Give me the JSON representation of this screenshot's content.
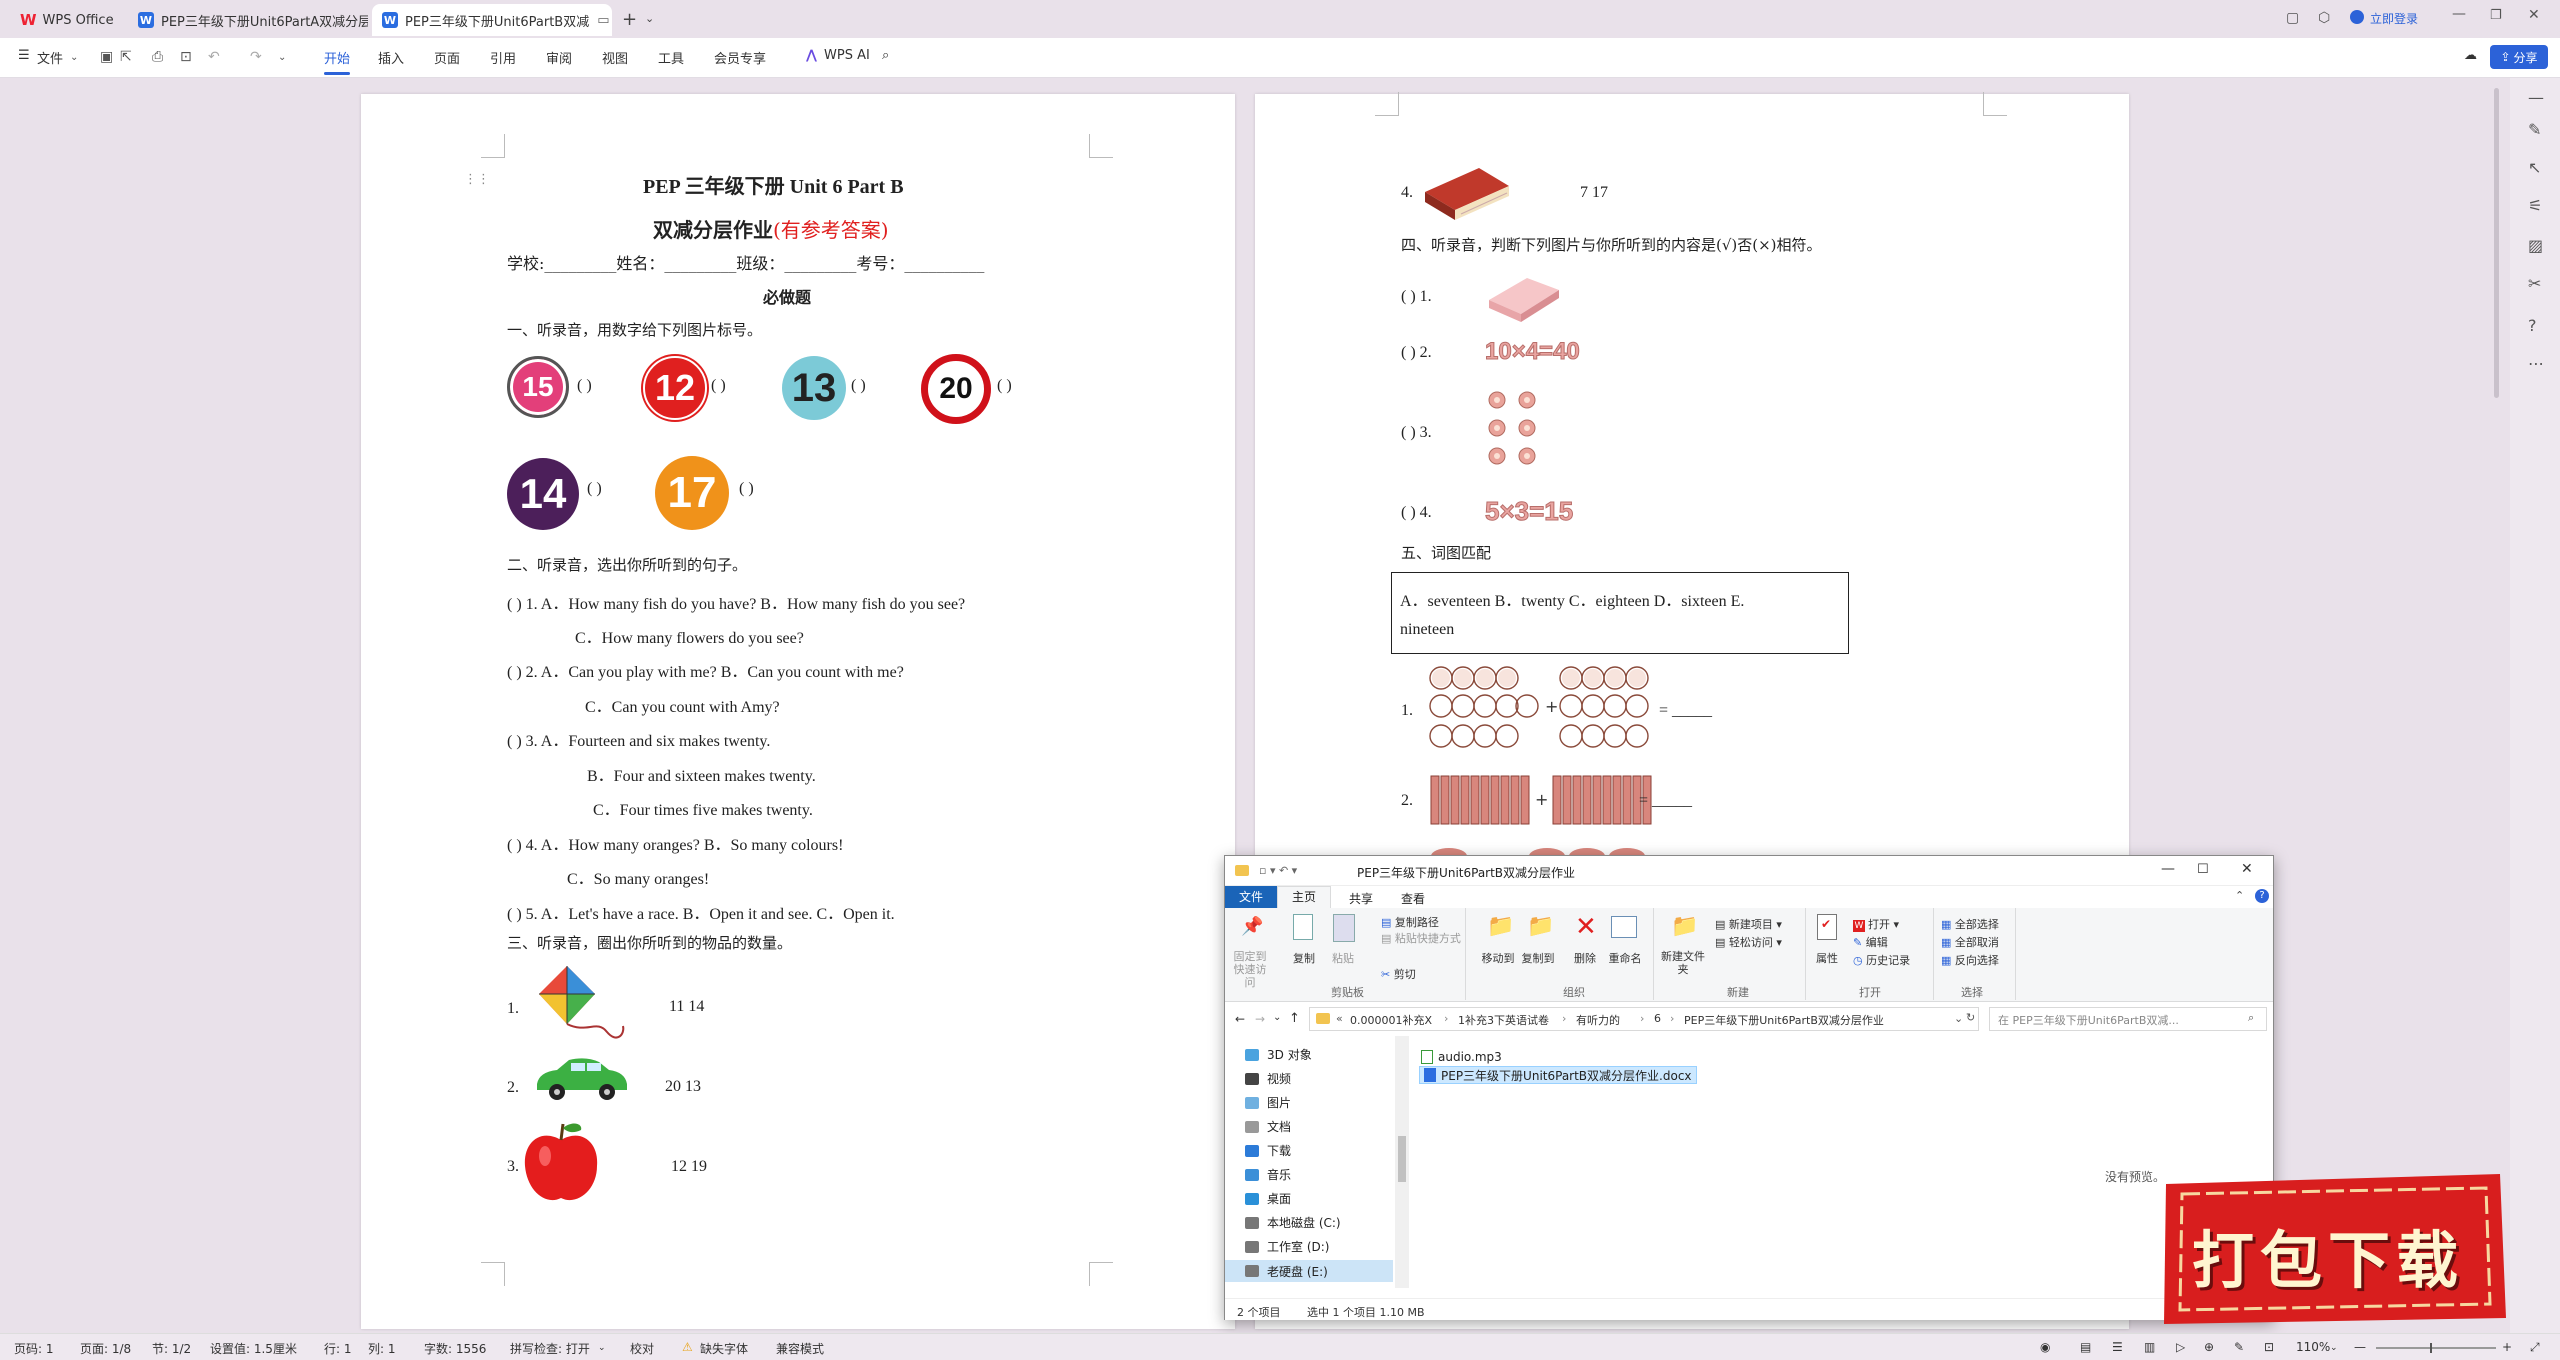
{
  "tabs": [
    {
      "label": "WPS Office"
    },
    {
      "label": "PEP三年级下册Unit6PartA双减分层作"
    },
    {
      "label": "PEP三年级下册Unit6PartB双减"
    }
  ],
  "titlebar": {
    "login": "立即登录"
  },
  "menu": {
    "file": "文件",
    "items": [
      "开始",
      "插入",
      "页面",
      "引用",
      "审阅",
      "视图",
      "工具",
      "会员专享"
    ],
    "ai": "WPS AI",
    "share": "分享"
  },
  "doc": {
    "title": "PEP 三年级下册 Unit 6 Part B",
    "subtitle": "双减分层作业",
    "subtitle_red": "(有参考答案)",
    "info": "学校:_________姓名：_________班级：_________考号：__________",
    "must": "必做题",
    "s1": "一、听录音，用数字给下列图片标号。",
    "s1_numbers": [
      "15",
      "12",
      "13",
      "20",
      "14",
      "17"
    ],
    "paren": "(        )",
    "s2": "二、听录音，选出你所听到的句子。",
    "s2_lines": [
      "(        ) 1. A．How many fish do you have?  B．How many fish do you see?",
      "C．How many flowers do you see?",
      "(        ) 2. A．Can you play with me?  B．Can you count with me?",
      "C．Can you count with Amy?",
      "(        ) 3. A．Fourteen and six makes twenty.",
      "B．Four and sixteen makes twenty.",
      "C．Four times five makes twenty.",
      "(        ) 4. A．How many oranges?      B．So many colours!",
      "C．So many oranges!",
      "(        ) 5. A．Let's have a race. B．Open it and see. C．Open it."
    ],
    "s3": "三、听录音，圈出你所听到的物品的数量。",
    "s3_items": [
      {
        "n": "1.",
        "v": "11    14"
      },
      {
        "n": "2.",
        "v": "20 13"
      },
      {
        "n": "3.",
        "v": "12 19"
      }
    ],
    "p2_item4": {
      "n": "4.",
      "v": "7 17"
    },
    "s4": "四、听录音，判断下列图片与你所听到的内容是(√)否(×)相符。",
    "s4_items": [
      "(        ) 1.",
      "(        ) 2.",
      "(        ) 3.",
      "(        ) 4."
    ],
    "s4_eq2": "10×4=40",
    "s4_eq4": "5×3=15",
    "s5": "五、词图匹配",
    "s5_box1": "A．seventeen  B．twenty  C．eighteen  D．sixteen  E.",
    "s5_box2": "nineteen",
    "s5_q1": "1.",
    "s5_q2": "2.",
    "s5_blank": "= _____"
  },
  "explorer": {
    "title": "PEP三年级下册Unit6PartB双减分层作业",
    "tabs": [
      "文件",
      "主页",
      "共享",
      "查看"
    ],
    "ribbon": {
      "pin": "固定到快速访问",
      "copy": "复制",
      "paste": "粘贴",
      "copypath": "复制路径",
      "pasteshortcut": "粘贴快捷方式",
      "cut": "剪切",
      "clipboard": "剪贴板",
      "moveto": "移动到",
      "copyto": "复制到",
      "delete": "删除",
      "rename": "重命名",
      "organize": "组织",
      "newfolder": "新建文件夹",
      "newitem": "新建项目",
      "easyaccess": "轻松访问",
      "new": "新建",
      "properties": "属性",
      "open": "打开",
      "edit": "编辑",
      "history": "历史记录",
      "openg": "打开",
      "selectall": "全部选择",
      "selectnone": "全部取消",
      "invert": "反向选择",
      "select": "选择"
    },
    "path": [
      "0.000001补充X",
      "1补充3下英语试卷",
      "有听力的",
      "6",
      "PEP三年级下册Unit6PartB双减分层作业"
    ],
    "search_placeholder": "在 PEP三年级下册Unit6PartB双减...",
    "nav": [
      "3D 对象",
      "视频",
      "图片",
      "文档",
      "下载",
      "音乐",
      "桌面",
      "本地磁盘 (C:)",
      "工作室 (D:)",
      "老硬盘 (E:)"
    ],
    "files": [
      "audio.mp3",
      "PEP三年级下册Unit6PartB双减分层作业.docx"
    ],
    "nopreview": "没有预览。",
    "status": "2 个项目",
    "status2": "选中 1 个项目  1.10 MB"
  },
  "statusbar": {
    "page": "页码: 1",
    "pages": "页面: 1/8",
    "section": "节: 1/2",
    "setting": "设置值: 1.5厘米",
    "row": "行: 1",
    "col": "列: 1",
    "words": "字数: 1556",
    "spell": "拼写检查: 打开",
    "proof": "校对",
    "missingfont": "缺失字体",
    "compat": "兼容模式",
    "zoom": "110%"
  },
  "banner": {
    "text": "打包下载"
  },
  "colors": {
    "accent": "#2c62d8",
    "red": "#e0201f",
    "banner": "#d81e1e"
  }
}
